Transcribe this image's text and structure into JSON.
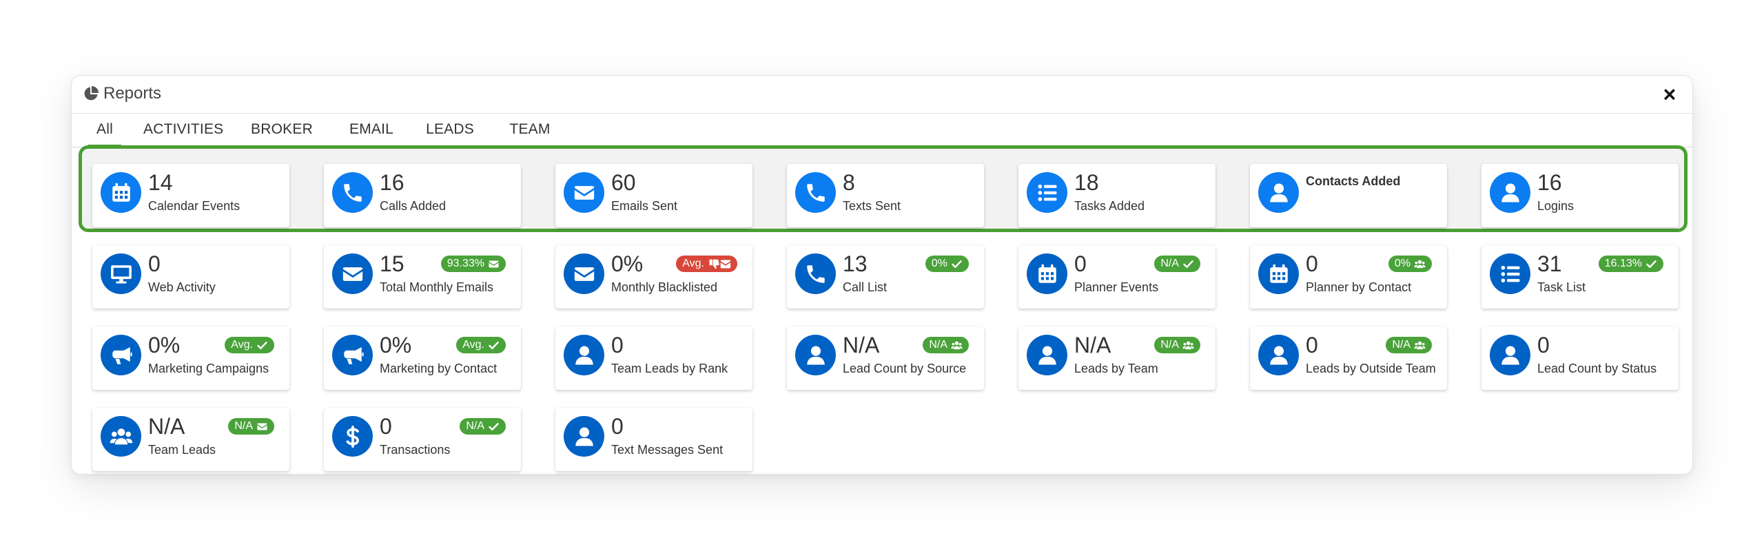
{
  "window": {
    "title": "Reports",
    "close_label": "×"
  },
  "tabs": [
    {
      "label": "All",
      "active": true
    },
    {
      "label": "ACTIVITIES"
    },
    {
      "label": "BROKER"
    },
    {
      "label": "EMAIL"
    },
    {
      "label": "LEADS"
    },
    {
      "label": "TEAM"
    }
  ],
  "colors": {
    "accent": "#4a9f32",
    "icon_blue_primary": "#0b7df0",
    "icon_blue": "#0062c4",
    "badge_green": "#4aa23a",
    "badge_red": "#d8473a"
  },
  "cards": [
    {
      "value": "14",
      "label": "Calendar Events",
      "icon": "calendar-icon",
      "badge": null
    },
    {
      "value": "16",
      "label": "Calls Added",
      "icon": "phone-icon",
      "badge": null
    },
    {
      "value": "60",
      "label": "Emails Sent",
      "icon": "envelope-icon",
      "badge": null
    },
    {
      "value": "8",
      "label": "Texts Sent",
      "icon": "phone-icon",
      "badge": null
    },
    {
      "value": "18",
      "label": "Tasks Added",
      "icon": "list-icon",
      "badge": null
    },
    {
      "value": "",
      "label": "Contacts Added",
      "icon": "user-icon",
      "badge": null,
      "bold_label": true
    },
    {
      "value": "16",
      "label": "Logins",
      "icon": "user-icon",
      "badge": null
    },
    {
      "value": "0",
      "label": "Web Activity",
      "icon": "monitor-icon",
      "badge": null
    },
    {
      "value": "15",
      "label": "Total Monthly Emails",
      "icon": "envelope-icon",
      "badge": {
        "text": "93.33%",
        "color": "green",
        "icon": "envelope-icon"
      }
    },
    {
      "value": "0%",
      "label": "Monthly Blacklisted",
      "icon": "envelope-icon",
      "badge": {
        "text": "Avg.",
        "color": "red",
        "icon": "thumbs-down-envelope-icon"
      }
    },
    {
      "value": "13",
      "label": "Call List",
      "icon": "phone-icon",
      "badge": {
        "text": "0%",
        "color": "green",
        "icon": "check-icon"
      }
    },
    {
      "value": "0",
      "label": "Planner Events",
      "icon": "calendar-icon",
      "badge": {
        "text": "N/A",
        "color": "green",
        "icon": "check-icon"
      }
    },
    {
      "value": "0",
      "label": "Planner by Contact",
      "icon": "calendar-icon",
      "badge": {
        "text": "0%",
        "color": "green",
        "icon": "users-icon"
      }
    },
    {
      "value": "31",
      "label": "Task List",
      "icon": "list-icon",
      "badge": {
        "text": "16.13%",
        "color": "green",
        "icon": "check-icon"
      }
    },
    {
      "value": "0%",
      "label": "Marketing Campaigns",
      "icon": "megaphone-icon",
      "badge": {
        "text": "Avg.",
        "color": "green",
        "icon": "check-icon"
      }
    },
    {
      "value": "0%",
      "label": "Marketing by Contact",
      "icon": "megaphone-icon",
      "badge": {
        "text": "Avg.",
        "color": "green",
        "icon": "check-icon"
      }
    },
    {
      "value": "0",
      "label": "Team Leads by Rank",
      "icon": "user-icon",
      "badge": null
    },
    {
      "value": "N/A",
      "label": "Lead Count by Source",
      "icon": "user-icon",
      "badge": {
        "text": "N/A",
        "color": "green",
        "icon": "users-icon"
      }
    },
    {
      "value": "N/A",
      "label": "Leads by Team",
      "icon": "user-icon",
      "badge": {
        "text": "N/A",
        "color": "green",
        "icon": "users-icon"
      }
    },
    {
      "value": "0",
      "label": "Leads by Outside Team",
      "icon": "user-icon",
      "badge": {
        "text": "N/A",
        "color": "green",
        "icon": "users-icon"
      }
    },
    {
      "value": "0",
      "label": "Lead Count by Status",
      "icon": "user-icon",
      "badge": null
    },
    {
      "value": "N/A",
      "label": "Team Leads",
      "icon": "users-icon",
      "badge": {
        "text": "N/A",
        "color": "green",
        "icon": "envelope-icon"
      }
    },
    {
      "value": "0",
      "label": "Transactions",
      "icon": "dollar-icon",
      "badge": {
        "text": "N/A",
        "color": "green",
        "icon": "check-icon"
      }
    },
    {
      "value": "0",
      "label": "Text Messages Sent",
      "icon": "user-icon",
      "badge": null
    }
  ]
}
